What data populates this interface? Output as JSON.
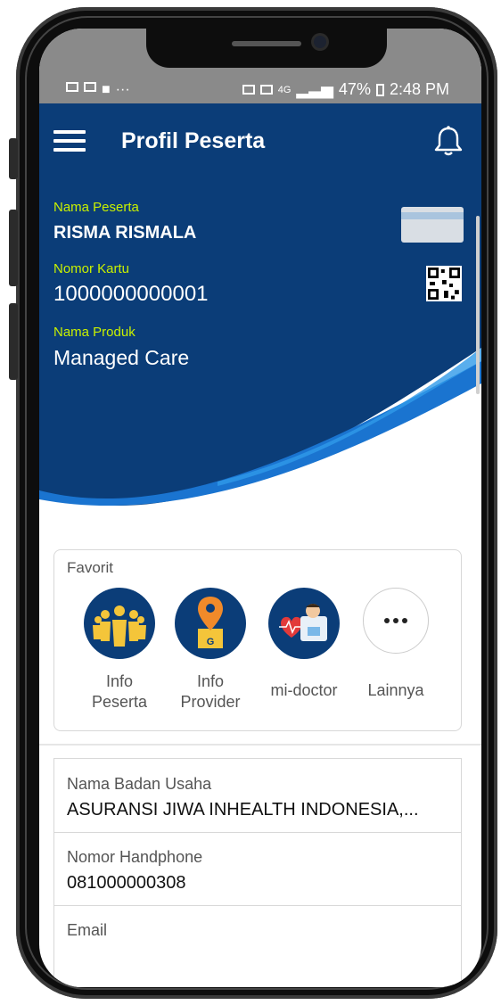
{
  "status": {
    "time": "2:48 PM",
    "battery": "47%",
    "network": "4G"
  },
  "header": {
    "title": "Profil Peserta"
  },
  "profile": {
    "name_label": "Nama Peserta",
    "name": "RISMA RISMALA",
    "card_label": "Nomor Kartu",
    "card": "1000000000001",
    "product_label": "Nama Produk",
    "product": "Managed Care"
  },
  "favorites": {
    "title": "Favorit",
    "items": [
      {
        "label": "Info Peserta",
        "icon": "people-icon"
      },
      {
        "label": "Info Provider",
        "icon": "location-pin-icon"
      },
      {
        "label": "mi-doctor",
        "icon": "doctor-icon"
      },
      {
        "label": "Lainnya",
        "icon": "more-icon"
      }
    ]
  },
  "info": {
    "rows": [
      {
        "label": "Nama Badan Usaha",
        "value": "ASURANSI JIWA INHEALTH INDONESIA,..."
      },
      {
        "label": "Nomor Handphone",
        "value": "081000000308"
      },
      {
        "label": "Email",
        "value": ""
      }
    ]
  },
  "colors": {
    "primary": "#0b3d78",
    "accent": "#c8f000",
    "status_bar": "#8a8a8a"
  }
}
